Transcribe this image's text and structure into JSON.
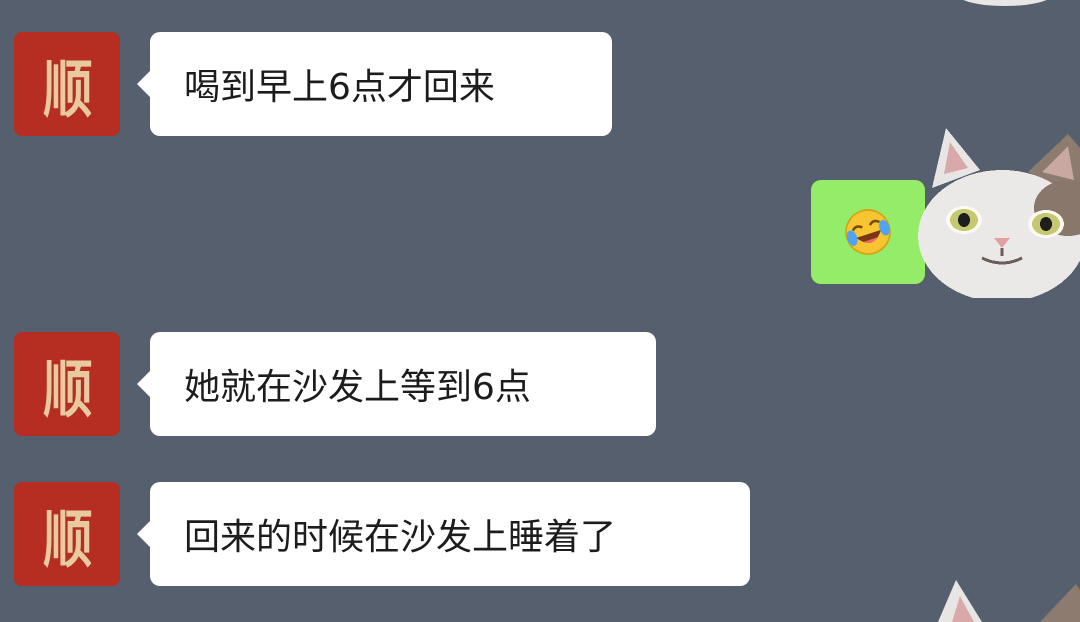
{
  "chat": {
    "messages": [
      {
        "sender": "left",
        "avatar_glyph": "顺",
        "text": "喝到早上6点才回来"
      },
      {
        "sender": "right",
        "emoji": "laughing-crying-emoji"
      },
      {
        "sender": "left",
        "avatar_glyph": "顺",
        "text": "她就在沙发上等到6点"
      },
      {
        "sender": "left",
        "avatar_glyph": "顺",
        "text": "回来的时候在沙发上睡着了"
      }
    ]
  },
  "colors": {
    "background": "#565f6d",
    "left_bubble": "#ffffff",
    "right_bubble": "#95ec69",
    "avatar_red": "#b62d22"
  }
}
